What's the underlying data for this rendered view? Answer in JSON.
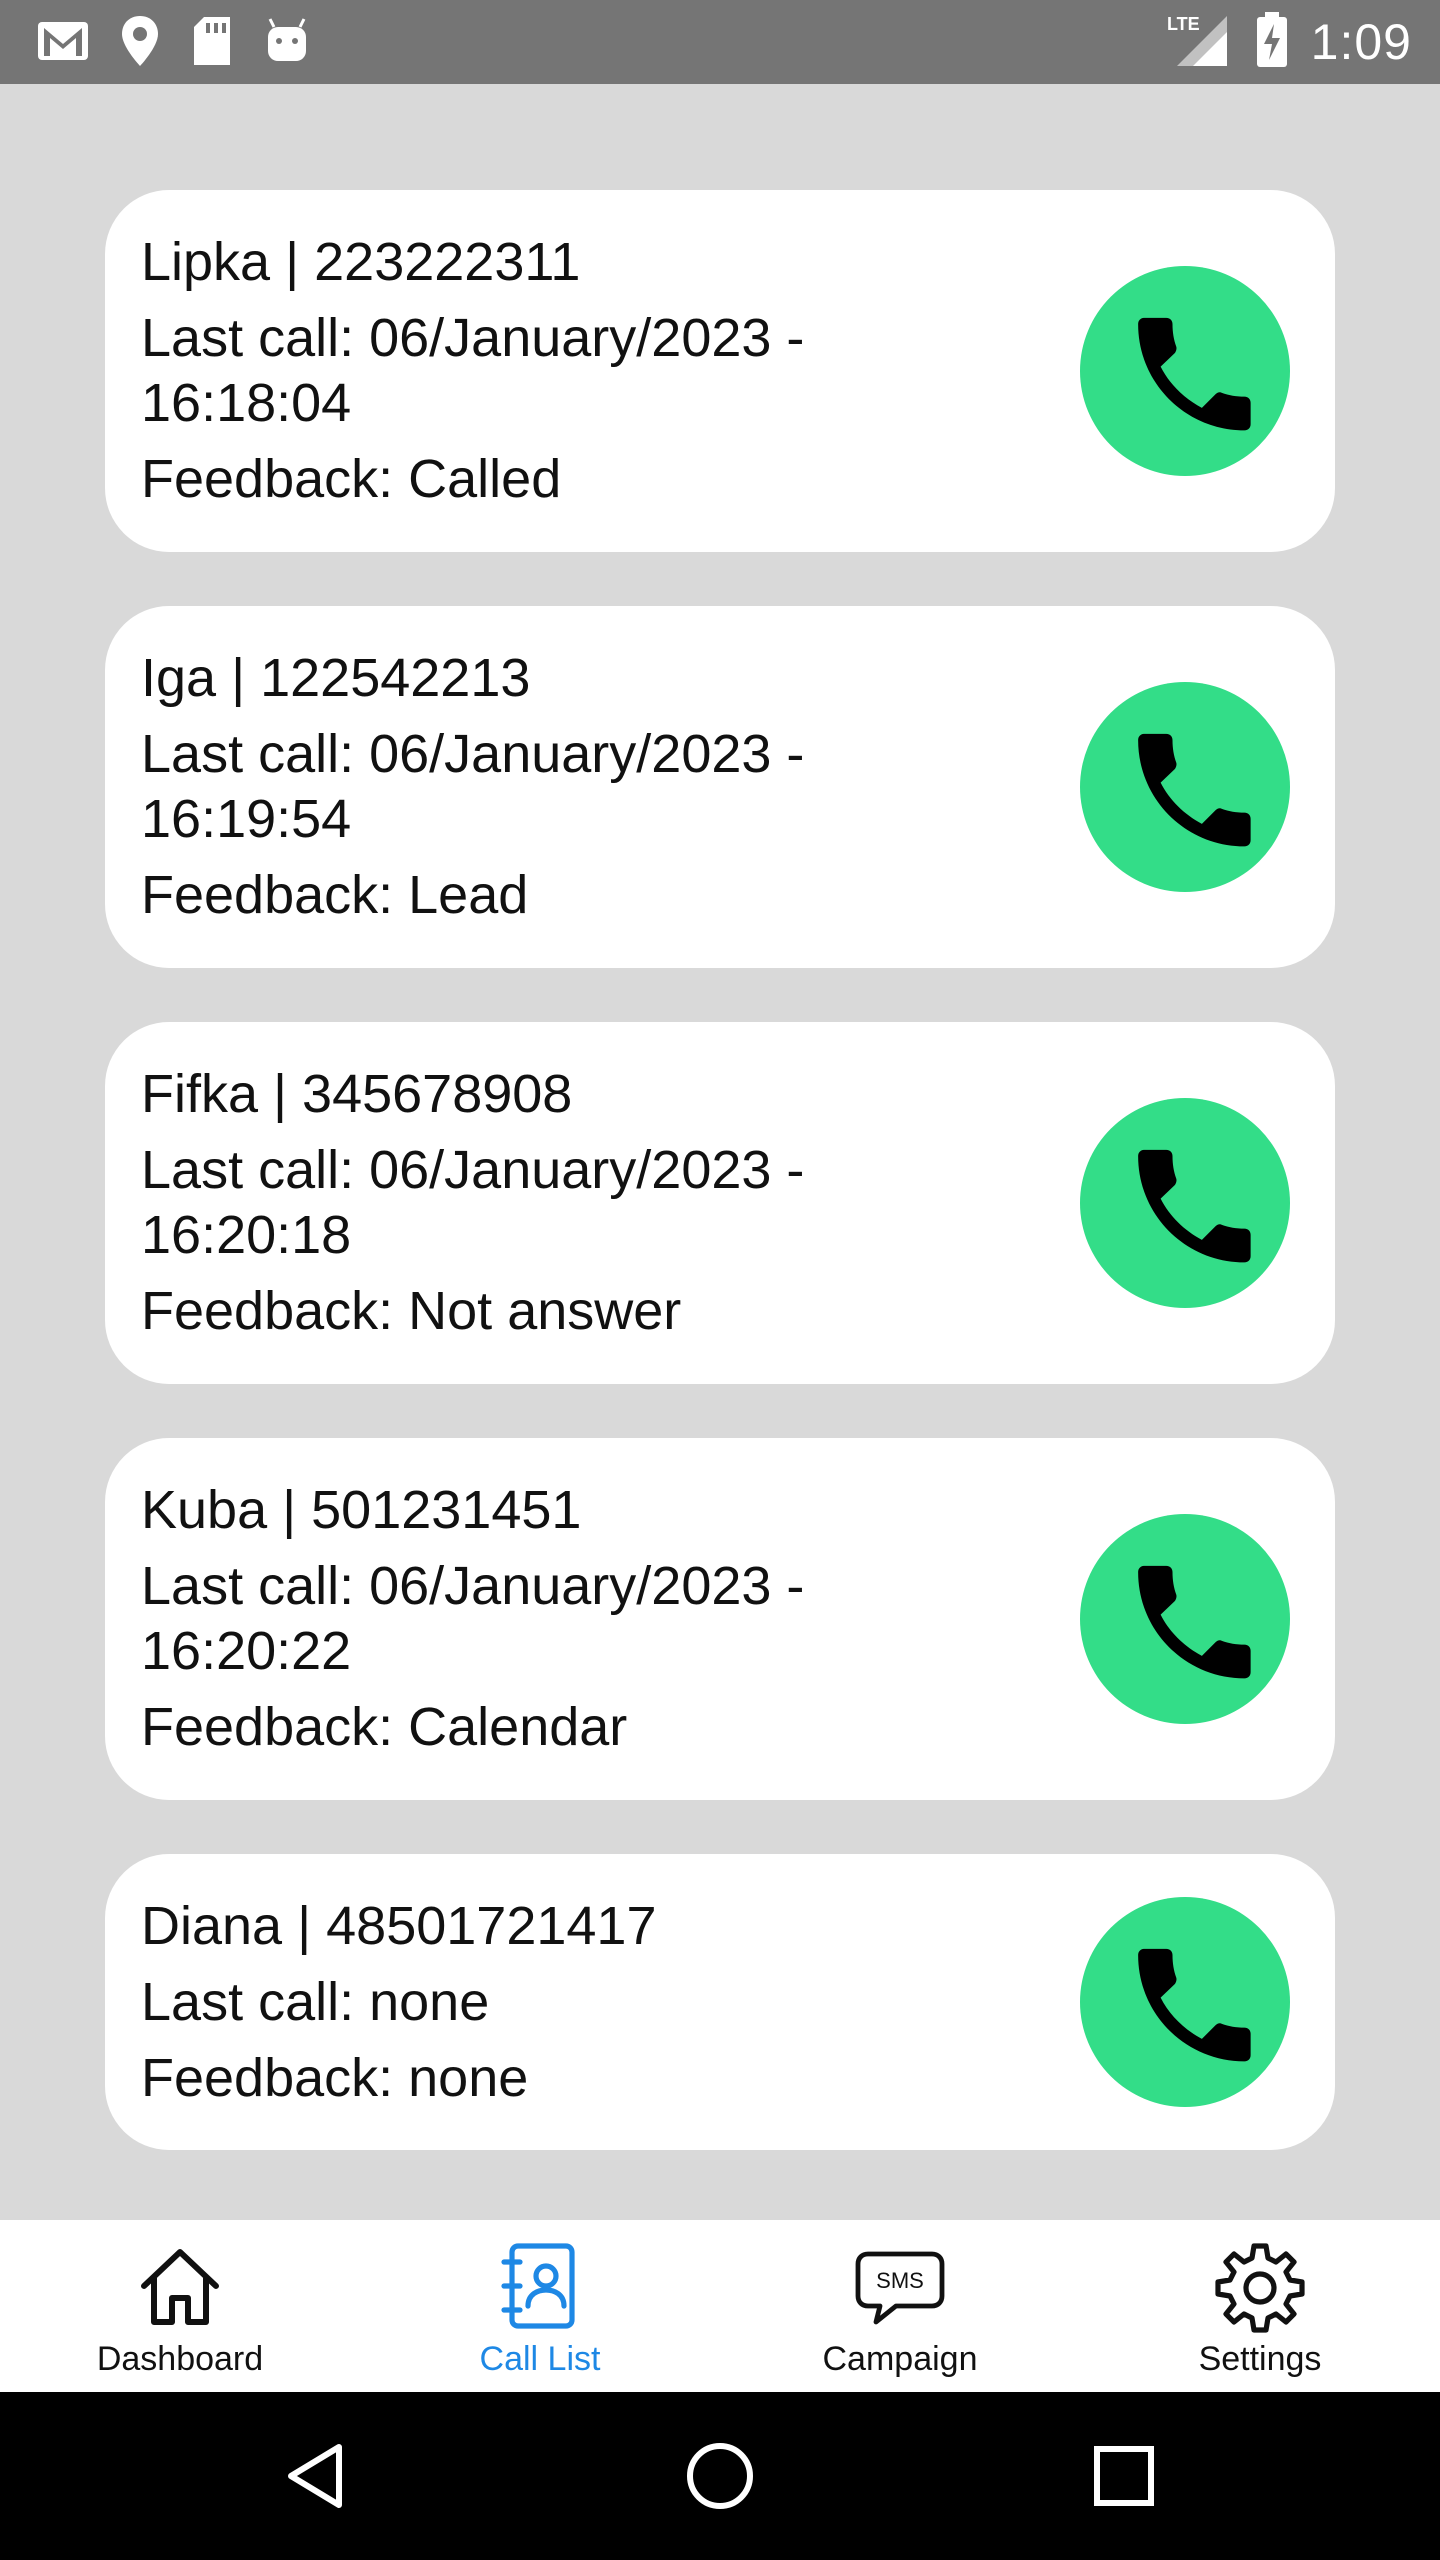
{
  "status_bar": {
    "time": "1:09",
    "network": "LTE",
    "icons": [
      "gmail-icon",
      "location-icon",
      "sd-card-icon",
      "android-icon",
      "signal-icon",
      "battery-charging-icon"
    ]
  },
  "contacts": [
    {
      "name_line": "Lipka | 223222311",
      "last_call": "Last call: 06/January/2023 - 16:18:04",
      "feedback": "Feedback: Called"
    },
    {
      "name_line": "Iga | 122542213",
      "last_call": "Last call: 06/January/2023 - 16:19:54",
      "feedback": "Feedback: Lead"
    },
    {
      "name_line": "Fifka | 345678908",
      "last_call": "Last call: 06/January/2023 - 16:20:18",
      "feedback": "Feedback: Not answer"
    },
    {
      "name_line": "Kuba | 501231451",
      "last_call": "Last call: 06/January/2023 - 16:20:22",
      "feedback": "Feedback: Calendar"
    },
    {
      "name_line": "Diana | 48501721417",
      "last_call": "Last call: none",
      "feedback": "Feedback: none"
    }
  ],
  "bottom_nav": {
    "items": [
      {
        "label": "Dashboard",
        "icon": "home-icon",
        "active": false
      },
      {
        "label": "Call List",
        "icon": "contacts-book-icon",
        "active": true
      },
      {
        "label": "Campaign",
        "icon": "sms-bubble-icon",
        "active": false,
        "icon_text": "SMS"
      },
      {
        "label": "Settings",
        "icon": "gear-icon",
        "active": false
      }
    ]
  },
  "colors": {
    "call_button": "#33dd88",
    "active_nav": "#1e88e5",
    "background": "#d9d9d9",
    "status_bar": "#757575"
  }
}
